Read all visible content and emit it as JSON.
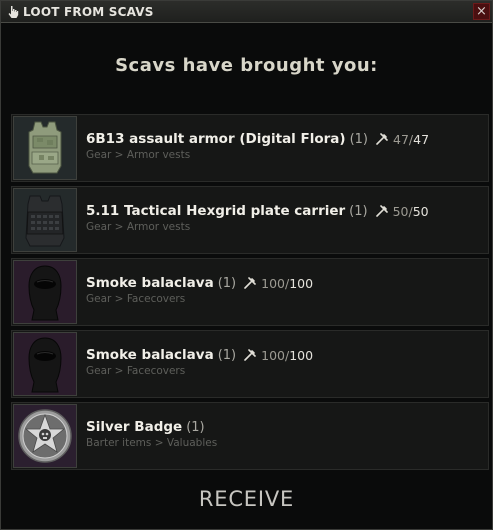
{
  "window": {
    "title": "LOOT FROM SCAVS",
    "close_label": "×"
  },
  "heading": "Scavs have brought you:",
  "items": [
    {
      "name": "6B13 assault armor (Digital Flora)",
      "qty": "(1)",
      "durability": "47",
      "durability_max": "47",
      "category": "Gear > Armor vests",
      "icon": "armor-vest-icon"
    },
    {
      "name": "5.11 Tactical Hexgrid plate carrier",
      "qty": "(1)",
      "durability": "50",
      "durability_max": "50",
      "category": "Gear > Armor vests",
      "icon": "plate-carrier-icon"
    },
    {
      "name": "Smoke balaclava",
      "qty": "(1)",
      "durability": "100",
      "durability_max": "100",
      "category": "Gear > Facecovers",
      "icon": "balaclava-icon"
    },
    {
      "name": "Smoke balaclava",
      "qty": "(1)",
      "durability": "100",
      "durability_max": "100",
      "category": "Gear > Facecovers",
      "icon": "balaclava-icon"
    },
    {
      "name": "Silver Badge",
      "qty": "(1)",
      "category": "Barter items > Valuables",
      "icon": "badge-icon"
    }
  ],
  "receive_label": "RECEIVE",
  "colors": {
    "background": "#0a0b0b",
    "row": "#161716",
    "gear_thumb": "#242a2b",
    "face_thumb": "#2a1c2b",
    "close": "#4a0f10"
  }
}
